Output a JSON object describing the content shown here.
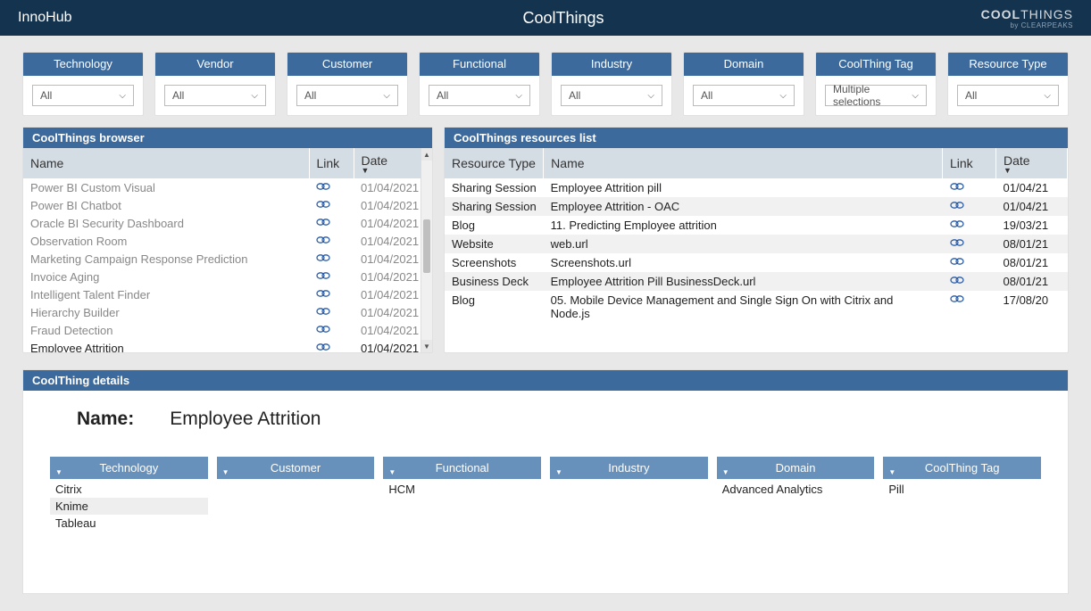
{
  "header": {
    "left": "InnoHub",
    "title": "CoolThings",
    "brand_bold": "COOL",
    "brand_rest": "THINGS",
    "brand_sub": "by CLEARPEAKS"
  },
  "filters": [
    {
      "label": "Technology",
      "value": "All"
    },
    {
      "label": "Vendor",
      "value": "All"
    },
    {
      "label": "Customer",
      "value": "All"
    },
    {
      "label": "Functional",
      "value": "All"
    },
    {
      "label": "Industry",
      "value": "All"
    },
    {
      "label": "Domain",
      "value": "All"
    },
    {
      "label": "CoolThing Tag",
      "value": "Multiple selections"
    },
    {
      "label": "Resource Type",
      "value": "All"
    }
  ],
  "browser": {
    "title": "CoolThings browser",
    "columns": {
      "name": "Name",
      "link": "Link",
      "date": "Date"
    },
    "rows": [
      {
        "name": "Power BI Custom Visual",
        "date": "01/04/2021",
        "active": false
      },
      {
        "name": "Power BI Chatbot",
        "date": "01/04/2021",
        "active": false
      },
      {
        "name": "Oracle BI Security Dashboard",
        "date": "01/04/2021",
        "active": false
      },
      {
        "name": "Observation Room",
        "date": "01/04/2021",
        "active": false
      },
      {
        "name": "Marketing Campaign Response Prediction",
        "date": "01/04/2021",
        "active": false
      },
      {
        "name": "Invoice Aging",
        "date": "01/04/2021",
        "active": false
      },
      {
        "name": "Intelligent Talent Finder",
        "date": "01/04/2021",
        "active": false
      },
      {
        "name": "Hierarchy Builder",
        "date": "01/04/2021",
        "active": false
      },
      {
        "name": "Fraud Detection",
        "date": "01/04/2021",
        "active": false
      },
      {
        "name": "Employee Attrition",
        "date": "01/04/2021",
        "active": true
      }
    ]
  },
  "resources": {
    "title": "CoolThings resources list",
    "columns": {
      "type": "Resource Type",
      "name": "Name",
      "link": "Link",
      "date": "Date"
    },
    "rows": [
      {
        "type": "Sharing Session",
        "name": "Employee Attrition pill",
        "date": "01/04/21"
      },
      {
        "type": "Sharing Session",
        "name": "Employee Attrition - OAC",
        "date": "01/04/21"
      },
      {
        "type": "Blog",
        "name": "11. Predicting Employee attrition",
        "date": "19/03/21"
      },
      {
        "type": "Website",
        "name": "web.url",
        "date": "08/01/21"
      },
      {
        "type": "Screenshots",
        "name": "Screenshots.url",
        "date": "08/01/21"
      },
      {
        "type": "Business Deck",
        "name": "Employee Attrition Pill BusinessDeck.url",
        "date": "08/01/21"
      },
      {
        "type": "Blog",
        "name": "05. Mobile Device Management and Single Sign On with Citrix and Node.js",
        "date": "17/08/20"
      }
    ]
  },
  "details": {
    "title": "CoolThing details",
    "name_label": "Name:",
    "name_value": "Employee Attrition",
    "groups": [
      {
        "label": "Technology",
        "items": [
          "Citrix",
          "Knime",
          "Tableau"
        ],
        "highlight_index": 1
      },
      {
        "label": "Customer",
        "items": []
      },
      {
        "label": "Functional",
        "items": [
          "HCM"
        ]
      },
      {
        "label": "Industry",
        "items": []
      },
      {
        "label": "Domain",
        "items": [
          "Advanced Analytics"
        ]
      },
      {
        "label": "CoolThing Tag",
        "items": [
          "Pill"
        ]
      }
    ]
  }
}
